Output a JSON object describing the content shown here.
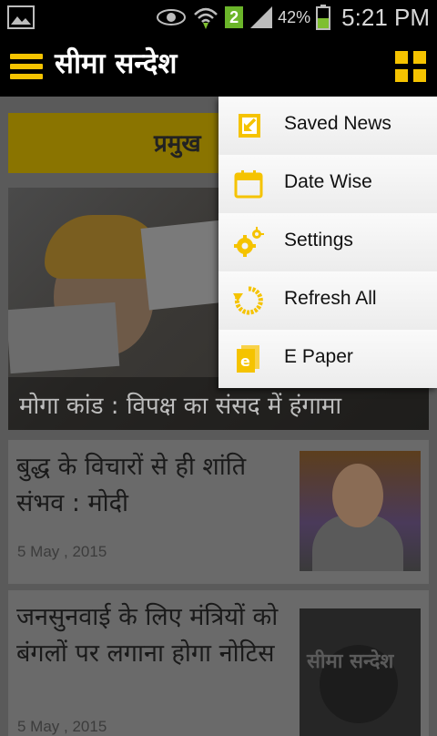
{
  "status_bar": {
    "battery": "42%",
    "time": "5:21 PM",
    "notification_count": "2"
  },
  "app_bar": {
    "title": "सीमा सन्देश"
  },
  "section": {
    "title": "प्रमुख"
  },
  "hero": {
    "caption": "मोगा कांड : विपक्ष का संसद में हंगामा"
  },
  "news": [
    {
      "title": "बुद्ध के विचारों से ही शांति संभव : मोदी",
      "date": "5 May , 2015"
    },
    {
      "title": "जनसुनवाई के लिए मंत्रियों को बंगलों पर लगाना होगा नोटिस",
      "date": "5 May , 2015",
      "thumb_logo": "सीमा सन्देश"
    }
  ],
  "menu": {
    "items": [
      {
        "label": "Saved News",
        "icon": "saved-news-icon"
      },
      {
        "label": "Date Wise",
        "icon": "calendar-icon"
      },
      {
        "label": "Settings",
        "icon": "gears-icon"
      },
      {
        "label": "Refresh All",
        "icon": "refresh-icon"
      },
      {
        "label": "E Paper",
        "icon": "e-paper-icon"
      }
    ]
  },
  "colors": {
    "accent": "#f5c300",
    "app_bar": "#000000",
    "menu_bg": "#f3f3f3"
  }
}
